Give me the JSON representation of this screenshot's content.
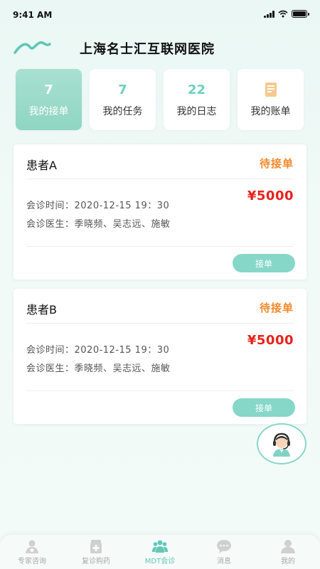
{
  "status_bar": {
    "time": "9:41 AM"
  },
  "header": {
    "title": "上海名士汇互联网医院",
    "logo_icon": "wave-logo-icon"
  },
  "tabs": [
    {
      "count": "7",
      "label": "我的接单",
      "active": true
    },
    {
      "count": "7",
      "label": "我的任务",
      "active": false
    },
    {
      "count": "22",
      "label": "我的日志",
      "active": false
    },
    {
      "count": "",
      "label": "我的账单",
      "active": false,
      "icon": "bill-icon"
    }
  ],
  "orders": [
    {
      "patient": "患者A",
      "status": "待接单",
      "price": "¥5000",
      "time_line": "会诊时间：2020-12-15  19：30",
      "doctors_line": "会诊医生：季晓频、吴志远、施敏",
      "accept_label": "接单"
    },
    {
      "patient": "患者B",
      "status": "待接单",
      "price": "¥5000",
      "time_line": "会诊时间：2020-12-15  19：30",
      "doctors_line": "会诊医生：季晓频、吴志远、施敏",
      "accept_label": "接单"
    }
  ],
  "fab": {
    "icon": "customer-service-icon"
  },
  "bottom_nav": [
    {
      "label": "专家咨询",
      "icon": "doctor-icon",
      "active": false
    },
    {
      "label": "复诊购药",
      "icon": "medicine-icon",
      "active": false
    },
    {
      "label": "MDT会诊",
      "icon": "group-icon",
      "active": true
    },
    {
      "label": "消息",
      "icon": "message-icon",
      "active": false
    },
    {
      "label": "我的",
      "icon": "profile-icon",
      "active": false
    }
  ],
  "colors": {
    "accent": "#86d7c8",
    "status_orange": "#f28a2e",
    "price_red": "#e8221b"
  }
}
